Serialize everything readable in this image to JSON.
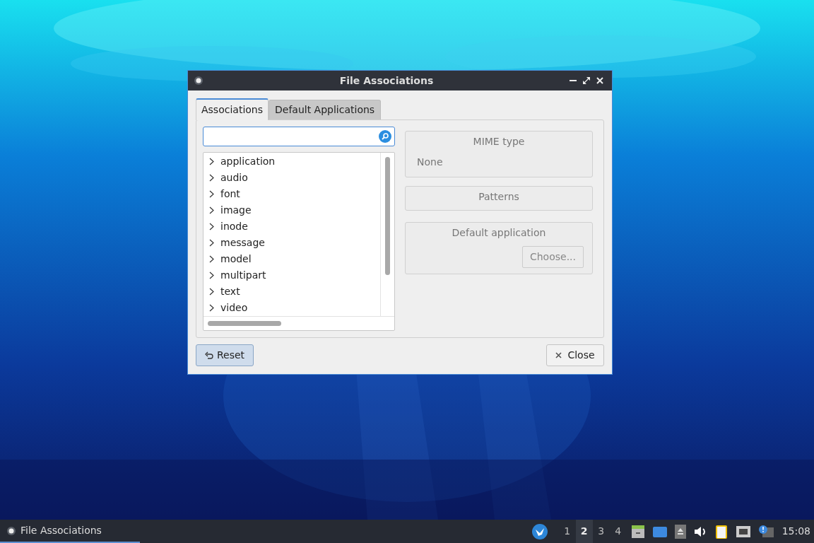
{
  "window": {
    "title": "File Associations"
  },
  "tabs": [
    {
      "label": "Associations",
      "selected": true
    },
    {
      "label": "Default Applications",
      "selected": false
    }
  ],
  "tree": [
    {
      "label": "application",
      "expanded": false
    },
    {
      "label": "audio",
      "expanded": false
    },
    {
      "label": "font",
      "expanded": false
    },
    {
      "label": "image",
      "expanded": false
    },
    {
      "label": "inode",
      "expanded": false
    },
    {
      "label": "message",
      "expanded": false
    },
    {
      "label": "model",
      "expanded": false
    },
    {
      "label": "multipart",
      "expanded": false
    },
    {
      "label": "text",
      "expanded": false
    },
    {
      "label": "video",
      "expanded": false
    }
  ],
  "mime_type": {
    "title": "MIME type",
    "value": "None"
  },
  "patterns": {
    "title": "Patterns"
  },
  "default_application": {
    "title": "Default application",
    "button": "Choose..."
  },
  "buttons": {
    "reset": "Reset",
    "close": "Close"
  },
  "taskbar": {
    "task": "File Associations",
    "workspaces": [
      {
        "label": "1",
        "selected": false
      },
      {
        "label": "2",
        "selected": true
      },
      {
        "label": "3",
        "selected": false
      },
      {
        "label": "4",
        "selected": false
      }
    ],
    "clock": "15:08"
  }
}
